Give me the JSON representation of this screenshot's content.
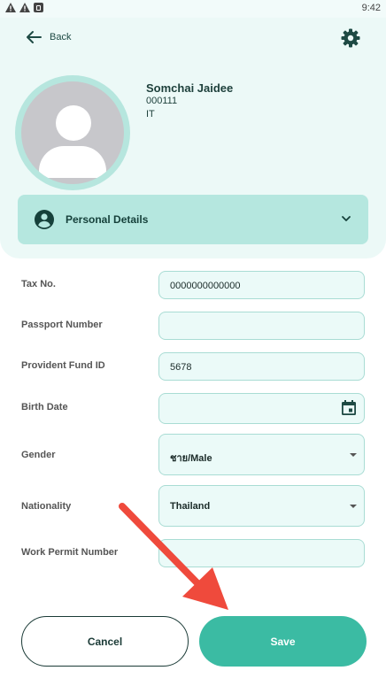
{
  "status_bar": {
    "time": "9:42"
  },
  "header": {
    "back_label": "Back"
  },
  "profile": {
    "name": "Somchai Jaidee",
    "employee_id": "000111",
    "department": "IT"
  },
  "section": {
    "title": "Personal Details"
  },
  "fields": {
    "tax_no": {
      "label": "Tax No.",
      "value": "0000000000000"
    },
    "passport_number": {
      "label": "Passport Number",
      "value": ""
    },
    "provident_fund_id": {
      "label": "Provident Fund ID",
      "value": "5678"
    },
    "birth_date": {
      "label": "Birth Date",
      "value": ""
    },
    "gender": {
      "label": "Gender",
      "value": "ชาย/Male"
    },
    "nationality": {
      "label": "Nationality",
      "value": "Thailand"
    },
    "work_permit_number": {
      "label": "Work Permit Number",
      "value": ""
    }
  },
  "actions": {
    "cancel_label": "Cancel",
    "save_label": "Save"
  },
  "colors": {
    "accent": "#3bbba3",
    "section_bg": "#b5e7df",
    "annotation_arrow": "#ef4a3c"
  }
}
